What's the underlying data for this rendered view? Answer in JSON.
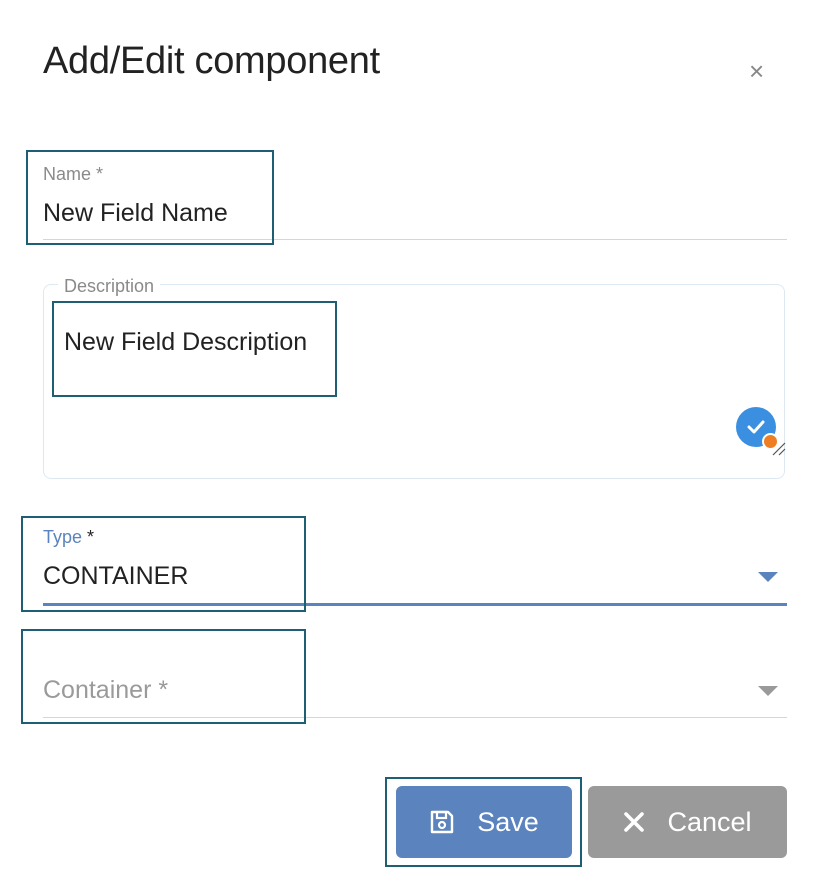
{
  "dialog": {
    "title": "Add/Edit component",
    "close_glyph": "×"
  },
  "fields": {
    "name": {
      "label": "Name *",
      "value": "New Field Name"
    },
    "description": {
      "label": "Description",
      "value": "New Field Description"
    },
    "type": {
      "label": "Type",
      "required_mark": "*",
      "value": "CONTAINER"
    },
    "container": {
      "placeholder": "Container *"
    }
  },
  "buttons": {
    "save_label": "Save",
    "cancel_label": "Cancel"
  },
  "colors": {
    "accent": "#5b83bd",
    "cancel": "#9a9a9a",
    "highlight": "#1f5f74",
    "grammar_badge": "#3a8fe0",
    "grammar_dot": "#ef7d22"
  },
  "icons": [
    "close-icon",
    "grammarly-check-icon",
    "resize-grip-icon",
    "chevron-down-icon",
    "save-disk-icon",
    "x-icon"
  ]
}
